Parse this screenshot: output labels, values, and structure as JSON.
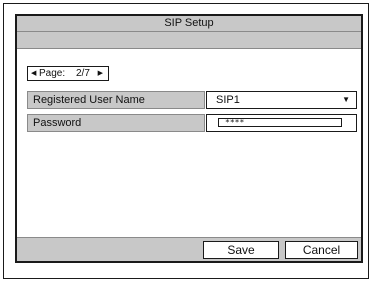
{
  "dialog": {
    "title": "SIP Setup"
  },
  "pager": {
    "label": "Page:",
    "value": "2/7",
    "prev_glyph": "◀",
    "next_glyph": "▶"
  },
  "fields": {
    "registered_user_name": {
      "label": "Registered User Name",
      "value": "SIP1",
      "dropdown_glyph": "▼"
    },
    "password": {
      "label": "Password",
      "value": "****"
    }
  },
  "buttons": {
    "save": "Save",
    "cancel": "Cancel"
  },
  "icons": {
    "prev": "triangle-left-icon",
    "next": "triangle-right-icon",
    "dropdown": "chevron-down-icon"
  },
  "colors": {
    "panel_gray": "#c8c8c8",
    "border": "#1a1a1a",
    "background": "#ffffff"
  }
}
